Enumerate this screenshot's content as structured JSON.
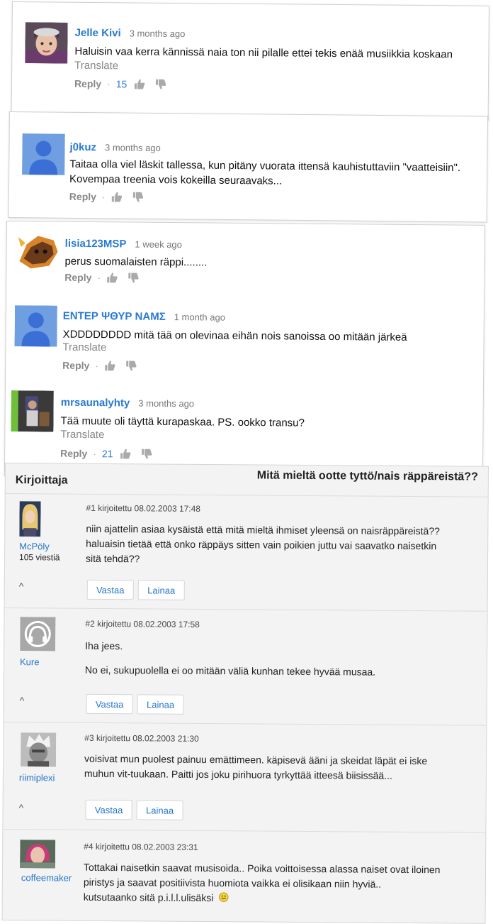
{
  "comments": [
    {
      "name": "Jelle Kivi",
      "time": "3 months ago",
      "text": "Haluisin vaa kerra kännissä naia ton nii pilalle ettei tekis enää musiikkia koskaan",
      "translate": "Translate",
      "reply": "Reply",
      "likes": "15"
    },
    {
      "name": "j0kuz",
      "time": "3 months ago",
      "text1": "Taitaa olla viel läskit tallessa, kun pitäny vuorata ittensä kauhistuttaviin \"vaatteisiin\".",
      "text2": "Kovempaa treenia vois kokeilla seuraavaks...",
      "reply": "Reply"
    },
    {
      "name": "lisia123MSP",
      "time": "1 week ago",
      "text": "perus suomalaisten räppi........",
      "reply": "Reply"
    },
    {
      "name": "ΕΝΤΕΡ ΨΘΥΡ ΝΑΜΣ",
      "time": "1 month ago",
      "text": "XDDDDDDDD mitä tää on olevinaa eihän nois sanoissa oo mitään järkeä",
      "translate": "Translate",
      "reply": "Reply"
    },
    {
      "name": "mrsaunalyhty",
      "time": "3 months ago",
      "text": "Tää muute oli täyttä kurapaskaa. PS. ookko transu?",
      "translate": "Translate",
      "reply": "Reply",
      "likes": "21"
    }
  ],
  "forum": {
    "header_left": "Kirjoittaja",
    "header_right": "Mitä mieltä ootte tyttö/nais räppäreistä??",
    "reply_button": "Vastaa",
    "quote_button": "Lainaa",
    "caret": "^",
    "posts": [
      {
        "user": "McPöly",
        "count": "105 viestiä",
        "meta": "#1 kirjoitettu 08.02.2003 17:48",
        "lines": [
          "niin ajattelin asiaa kysäistä että mitä mieltä ihmiset yleensä on naisräppäreistä??",
          "haluaisin tietää että onko räppäys sitten vain poikien juttu vai saavatko naisetkin",
          "sitä tehdä??"
        ]
      },
      {
        "user": "Kure",
        "meta": "#2 kirjoitettu 08.02.2003 17:58",
        "lines": [
          "Iha jees.",
          "No ei, sukupuolella ei oo mitään väliä kunhan tekee hyvää musaa."
        ]
      },
      {
        "user": "riimiplexi",
        "meta": "#3 kirjoitettu 08.02.2003 21:30",
        "lines": [
          "voisivat mun puolest painuu emättimeen. käpisevä ääni ja skeidat läpät ei iske",
          "muhun vit-tuukaan. Paitti jos joku pirihuora tyrkyttää itteesä biisissää..."
        ]
      },
      {
        "user": "coffeemaker",
        "meta": "#4 kirjoitettu 08.02.2003 23:31",
        "lines": [
          "Tottakai naisetkin saavat musisoida.. Poika voittoisessa alassa naiset ovat iloinen",
          "piristys ja saavat positiivista huomiota vaikka ei olisikaan niin hyviä..",
          "kutsutaanko sitä p.i.l.l.ulisäksi"
        ]
      }
    ]
  }
}
